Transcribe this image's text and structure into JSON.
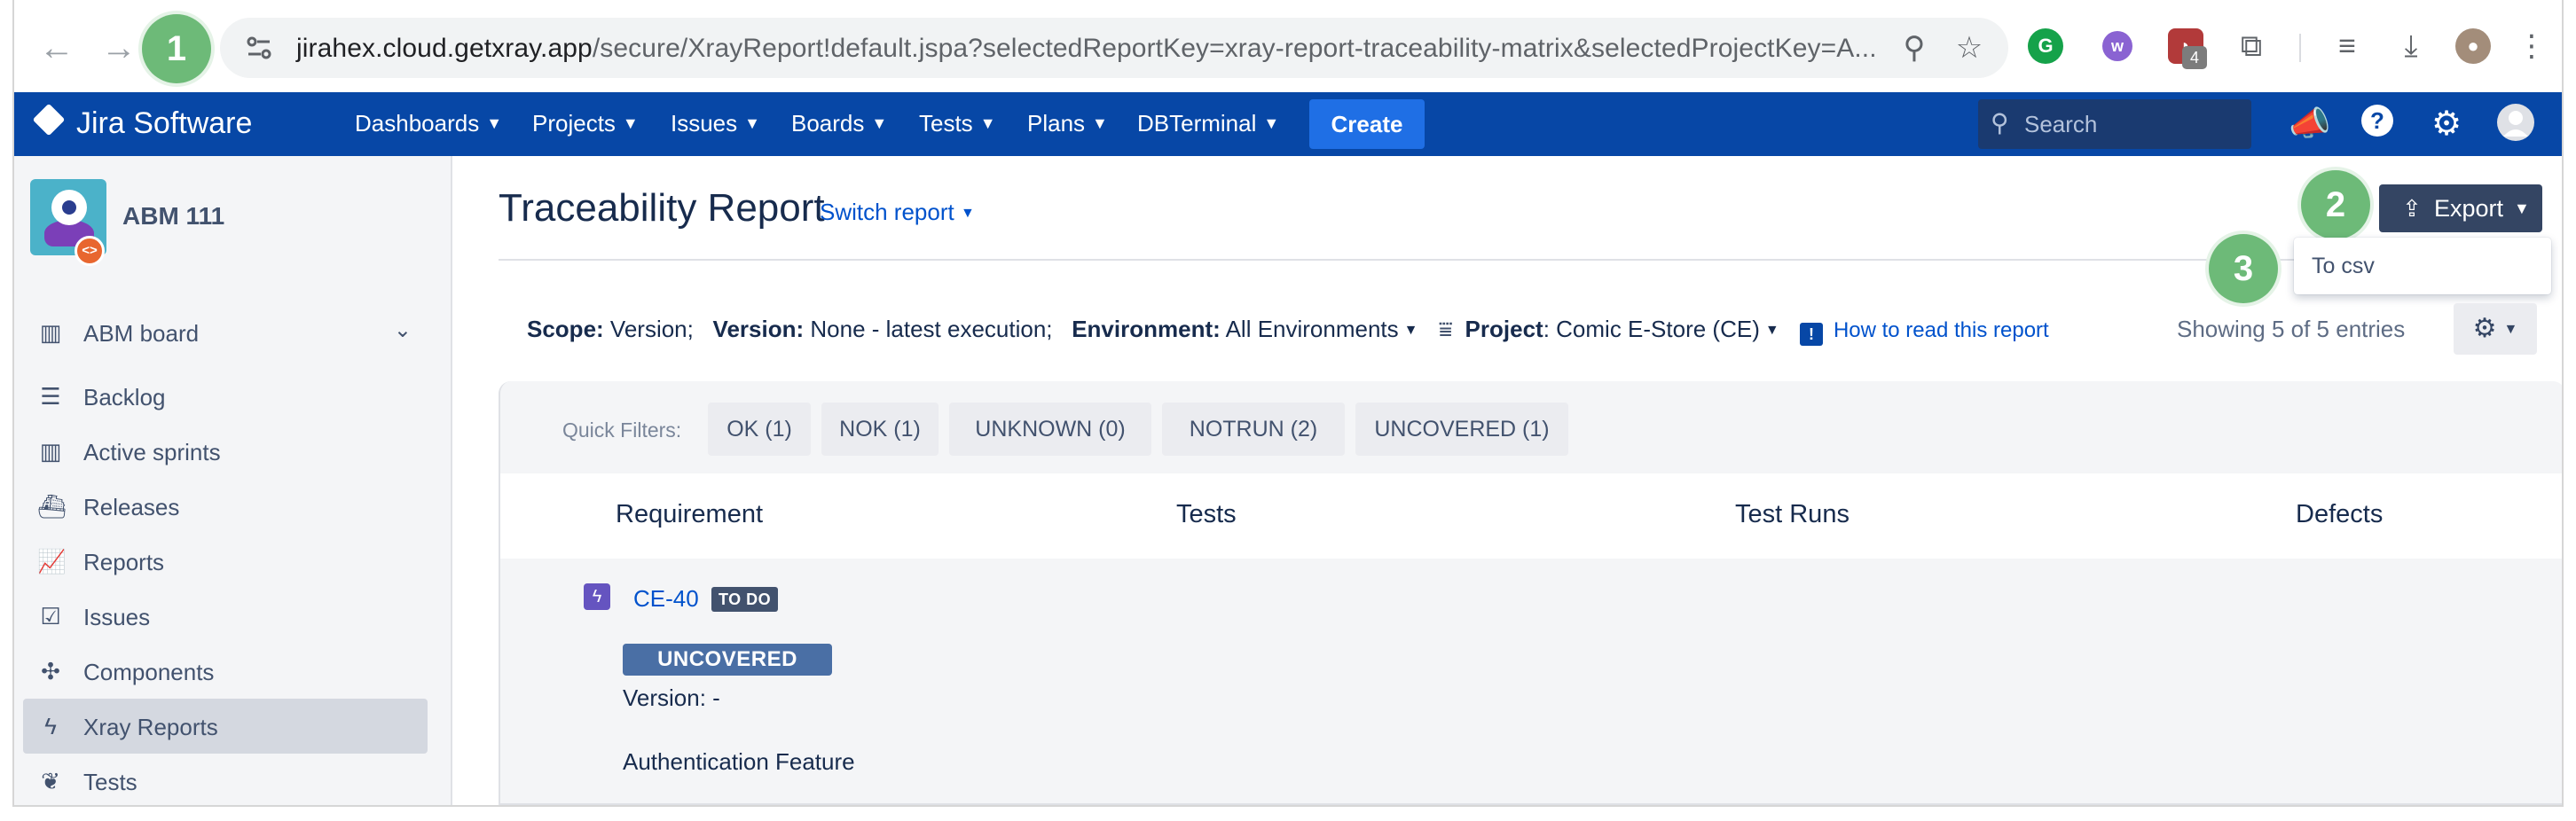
{
  "browser": {
    "url_host": "jirahex.cloud.getxray.app",
    "url_path": "/secure/XrayReport!default.jspa?selectedReportKey=xray-report-traceability-matrix&selectedProjectKey=A...",
    "extension_badge": "4"
  },
  "steps": {
    "one": "1",
    "two": "2",
    "three": "3"
  },
  "jira_nav": {
    "product": "Jira Software",
    "items": [
      "Dashboards",
      "Projects",
      "Issues",
      "Boards",
      "Tests",
      "Plans",
      "DBTerminal"
    ],
    "create_label": "Create",
    "search_placeholder": "Search"
  },
  "sidebar": {
    "project_name": "ABM 111",
    "board_label": "ABM board",
    "items": [
      {
        "label": "Backlog"
      },
      {
        "label": "Active sprints"
      },
      {
        "label": "Releases"
      },
      {
        "label": "Reports"
      },
      {
        "label": "Issues"
      },
      {
        "label": "Components"
      },
      {
        "label": "Xray Reports"
      },
      {
        "label": "Tests"
      }
    ]
  },
  "report": {
    "title": "Traceability Report",
    "switch_label": "Switch report",
    "export_label": "Export",
    "export_option": "To csv",
    "scope_key": "Scope:",
    "scope_val": "Version;",
    "version_key": "Version:",
    "version_val": "None - latest execution;",
    "env_key": "Environment:",
    "env_val": "All Environments",
    "project_key": "Project",
    "project_val": ": Comic E-Store (CE)",
    "how_to_read": "How to read this report",
    "showing": "Showing 5 of 5 entries",
    "quick_filters_label": "Quick Filters:",
    "quick_filters": [
      "OK (1)",
      "NOK (1)",
      "UNKNOWN (0)",
      "NOTRUN (2)",
      "UNCOVERED (1)"
    ],
    "columns": [
      "Requirement",
      "Tests",
      "Test Runs",
      "Defects"
    ],
    "row": {
      "key": "CE-40",
      "status": "TO DO",
      "coverage": "UNCOVERED",
      "version": "Version: -",
      "feature": "Authentication Feature"
    }
  },
  "colors": {
    "jira_blue": "#0747a6",
    "create_blue": "#1f6fe5",
    "export_dark": "#344563",
    "uncovered": "#4a6fa5",
    "step_green": "#6dba78"
  }
}
